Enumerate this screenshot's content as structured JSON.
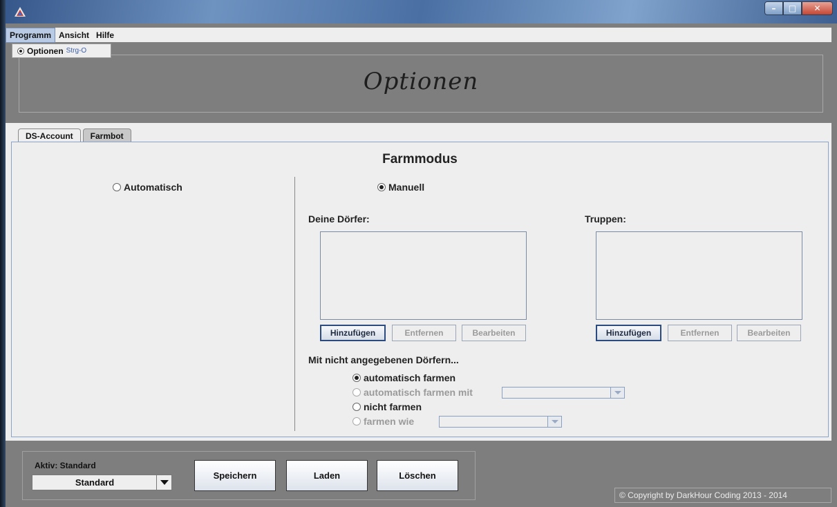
{
  "menu": {
    "items": [
      "Programm",
      "Ansicht",
      "Hilfe"
    ]
  },
  "dropdown": {
    "item_label": "Optionen",
    "item_shortcut": "Strg-O"
  },
  "header": {
    "title": "Optionen"
  },
  "tabs": [
    "DS-Account",
    "Farmbot"
  ],
  "farm": {
    "title": "Farmmodus",
    "auto_label": "Automatisch",
    "manual_label": "Manuell",
    "villages_label": "Deine Dörfer:",
    "troops_label": "Truppen:",
    "btn_add": "Hinzufügen",
    "btn_remove": "Entfernen",
    "btn_edit": "Bearbeiten",
    "unspecified_label": "Mit nicht angegebenen Dörfern...",
    "opt_auto_farm": "automatisch farmen",
    "opt_auto_farm_with": "automatisch farmen mit",
    "opt_no_farm": "nicht farmen",
    "opt_farm_like": "farmen wie"
  },
  "bottom": {
    "aktiv_label": "Aktiv: Standard",
    "profile_value": "Standard",
    "save_label": "Speichern",
    "load_label": "Laden",
    "delete_label": "Löschen",
    "copyright": "© Copyright by DarkHour Coding 2013 - 2014"
  }
}
